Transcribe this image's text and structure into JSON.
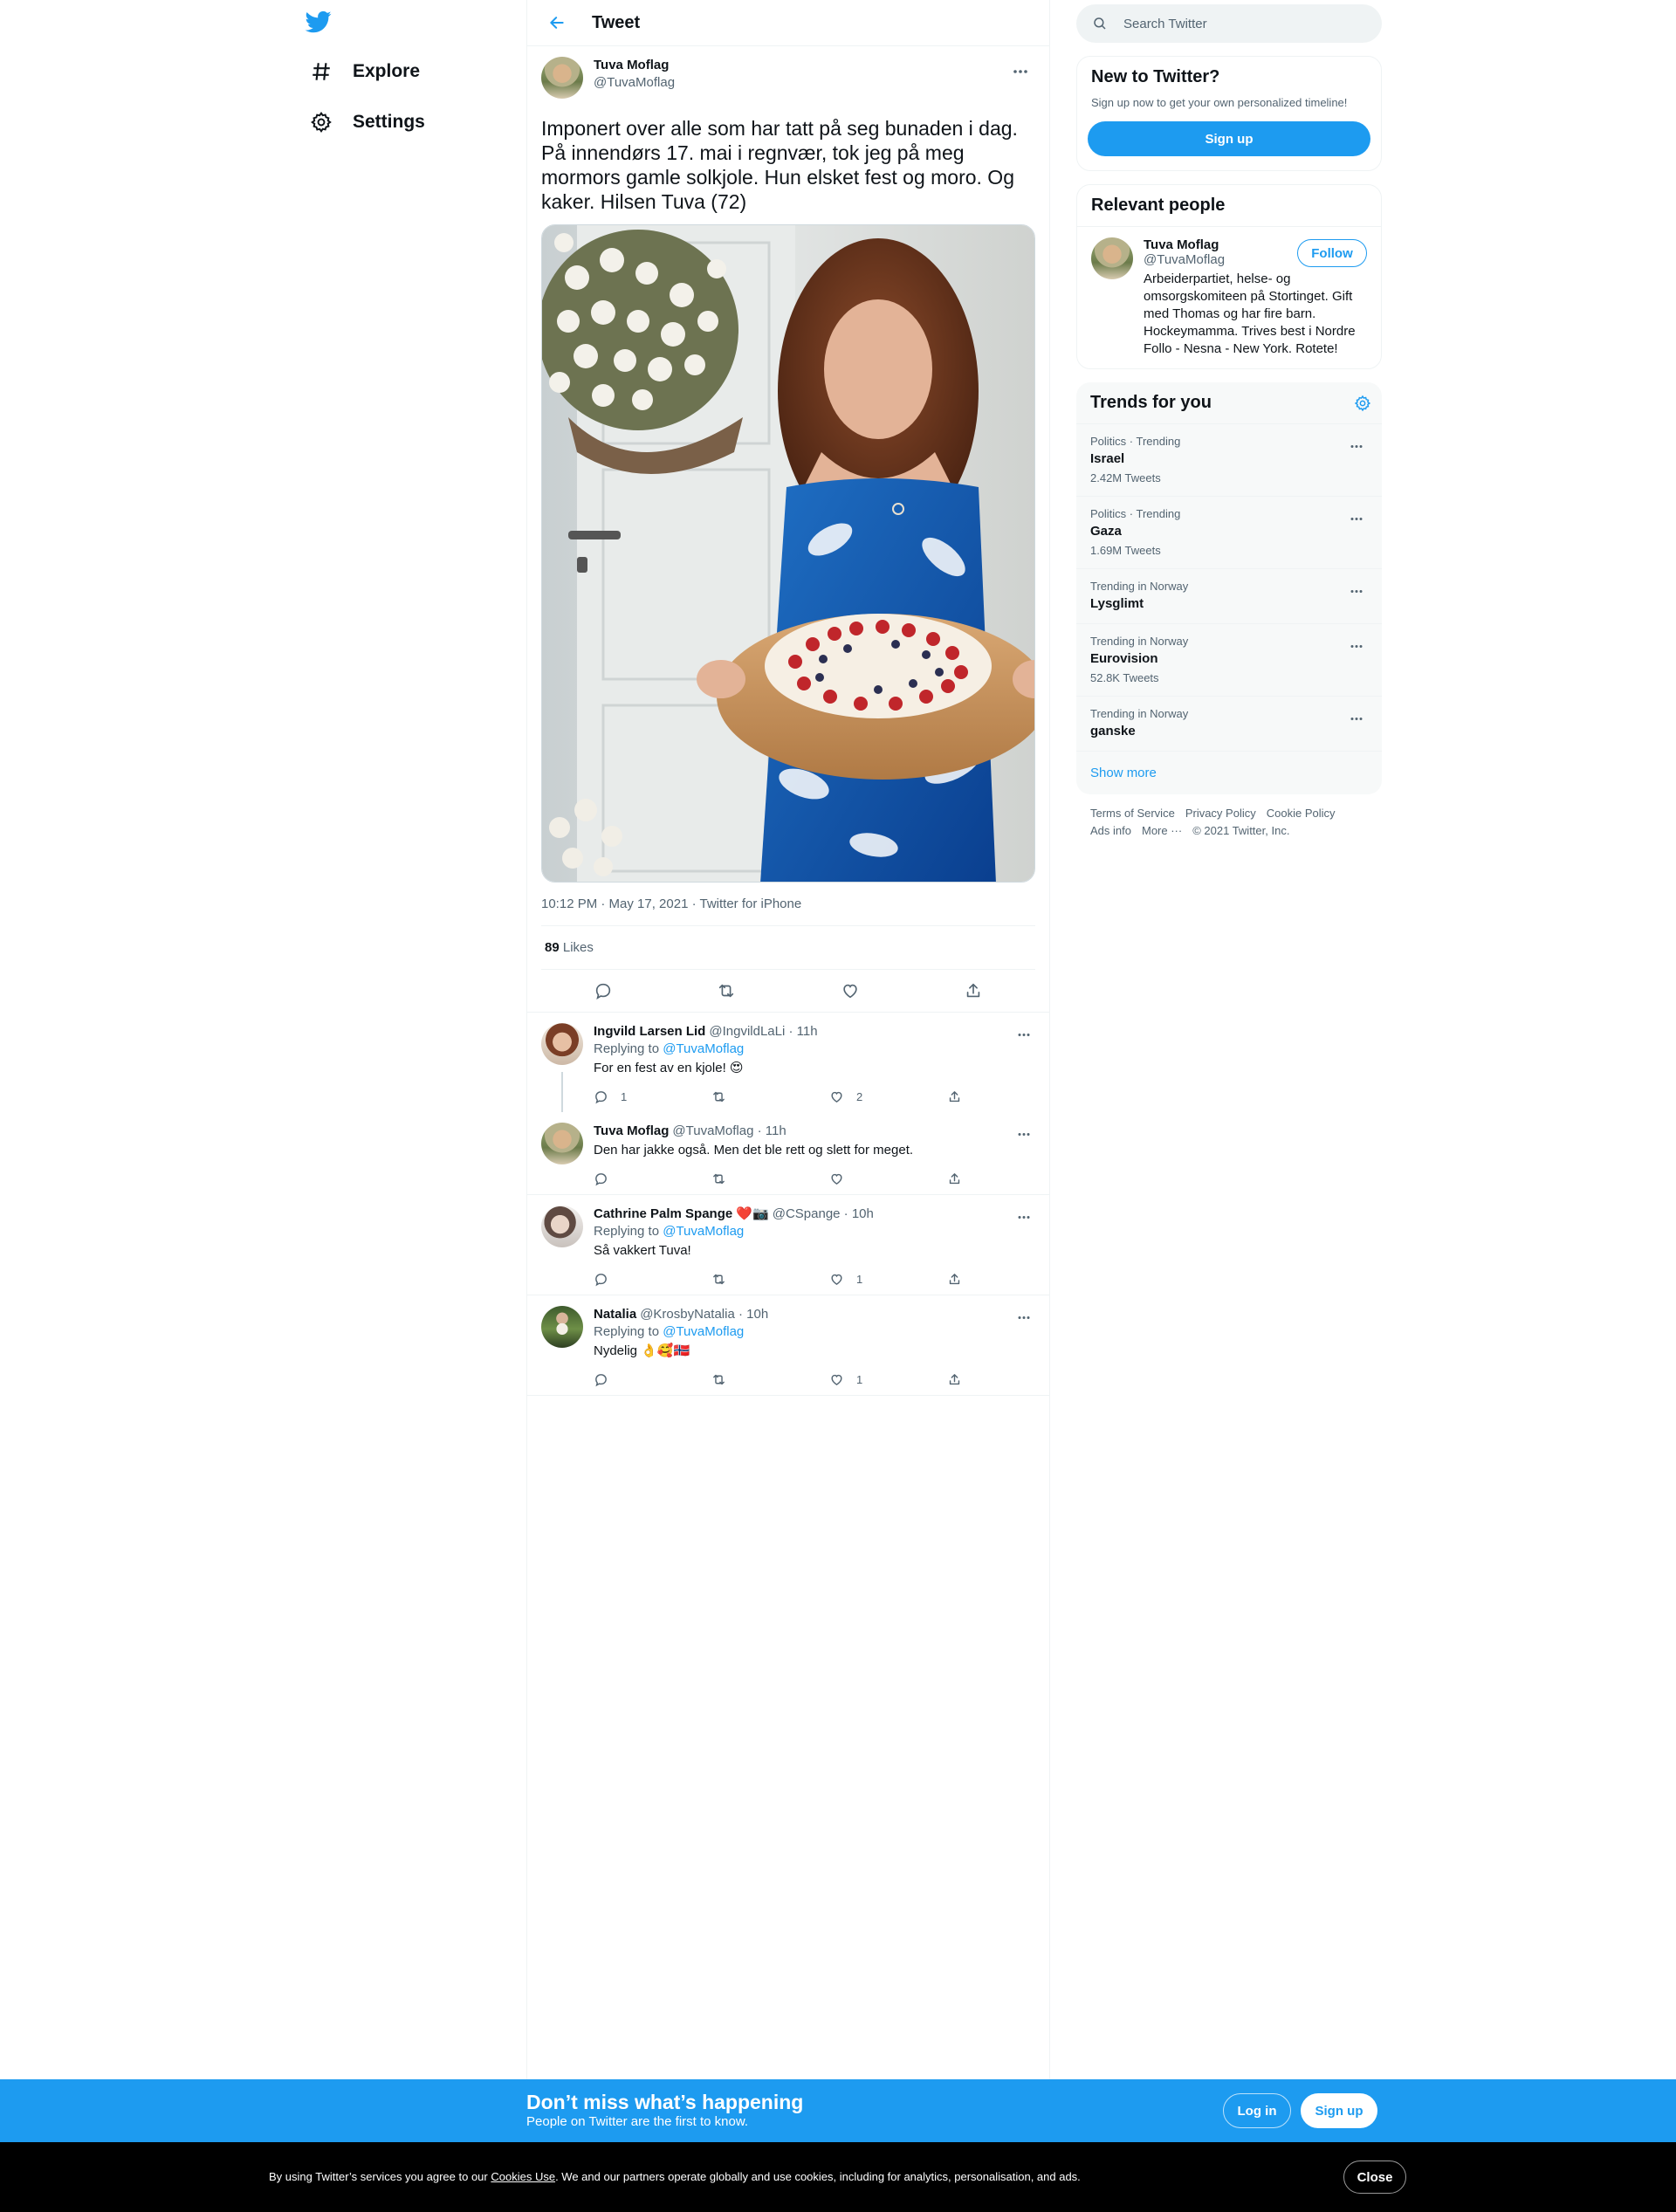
{
  "colors": {
    "accent": "#1d9bf0",
    "text": "#0f1419",
    "secondary": "#536471"
  },
  "nav": {
    "logo": "twitter-bird-icon",
    "items": [
      {
        "label": "Explore",
        "icon": "hashtag-icon"
      },
      {
        "label": "Settings",
        "icon": "gear-icon"
      }
    ]
  },
  "header": {
    "title": "Tweet"
  },
  "tweet": {
    "name": "Tuva Moflag",
    "handle": "@TuvaMoflag",
    "text": "Imponert over alle som har tatt på seg bunaden i dag. På innendørs 17. mai i regnvær, tok jeg på meg mormors gamle solkjole. Hun elsket fest og moro. Og kaker. Hilsen Tuva (72)",
    "meta": "10:12 PM · May 17, 2021 · Twitter for iPhone",
    "likes_count": "89",
    "likes_label": "Likes"
  },
  "replies": [
    {
      "name": "Ingvild Larsen Lid",
      "handle": "@IngvildLaLi · 11h",
      "replying_label": "Replying to",
      "replying_to": "@TuvaMoflag",
      "text": "For en fest av en kjole! 😍",
      "reply_count": "1",
      "retweet_count": "",
      "like_count": "2"
    },
    {
      "name": "Tuva Moflag",
      "handle": "@TuvaMoflag · 11h",
      "text": "Den har jakke også. Men det ble rett og slett for meget.",
      "reply_count": "",
      "retweet_count": "",
      "like_count": ""
    },
    {
      "name": "Cathrine Palm Spange ❤️📷",
      "handle": "@CSpange · 10h",
      "replying_label": "Replying to",
      "replying_to": "@TuvaMoflag",
      "text": "Så vakkert Tuva!",
      "reply_count": "",
      "retweet_count": "",
      "like_count": "1"
    },
    {
      "name": "Natalia",
      "handle": "@KrosbyNatalia · 10h",
      "replying_label": "Replying to",
      "replying_to": "@TuvaMoflag",
      "text": "Nydelig 👌🥰🇳🇴",
      "reply_count": "",
      "retweet_count": "",
      "like_count": "1"
    }
  ],
  "search": {
    "placeholder": "Search Twitter"
  },
  "new_to_twitter": {
    "title": "New to Twitter?",
    "subtitle": "Sign up now to get your own personalized timeline!",
    "button": "Sign up"
  },
  "relevant_people": {
    "title": "Relevant people",
    "name": "Tuva Moflag",
    "handle": "@TuvaMoflag",
    "follow": "Follow",
    "bio": "Arbeiderpartiet, helse- og omsorgskomiteen på Stortinget. Gift med Thomas og har fire barn. Hockeymamma. Trives best i Nordre Follo - Nesna - New York. Rotete!"
  },
  "trends": {
    "title": "Trends for you",
    "items": [
      {
        "context": "Politics · Trending",
        "name": "Israel",
        "count": "2.42M Tweets"
      },
      {
        "context": "Politics · Trending",
        "name": "Gaza",
        "count": "1.69M Tweets"
      },
      {
        "context": "Trending in Norway",
        "name": "Lysglimt",
        "count": ""
      },
      {
        "context": "Trending in Norway",
        "name": "Eurovision",
        "count": "52.8K Tweets"
      },
      {
        "context": "Trending in Norway",
        "name": "ganske",
        "count": ""
      }
    ],
    "show_more": "Show more"
  },
  "footer": {
    "links": [
      "Terms of Service",
      "Privacy Policy",
      "Cookie Policy",
      "Ads info",
      "More ···"
    ],
    "copyright": "© 2021 Twitter, Inc."
  },
  "banner": {
    "title": "Don’t miss what’s happening",
    "subtitle": "People on Twitter are the first to know.",
    "login": "Log in",
    "signup": "Sign up"
  },
  "cookie": {
    "before": "By using Twitter’s services you agree to our ",
    "link": "Cookies Use",
    "after": ". We and our partners operate globally and use cookies, including for analytics, personalisation, and ads.",
    "close": "Close"
  }
}
